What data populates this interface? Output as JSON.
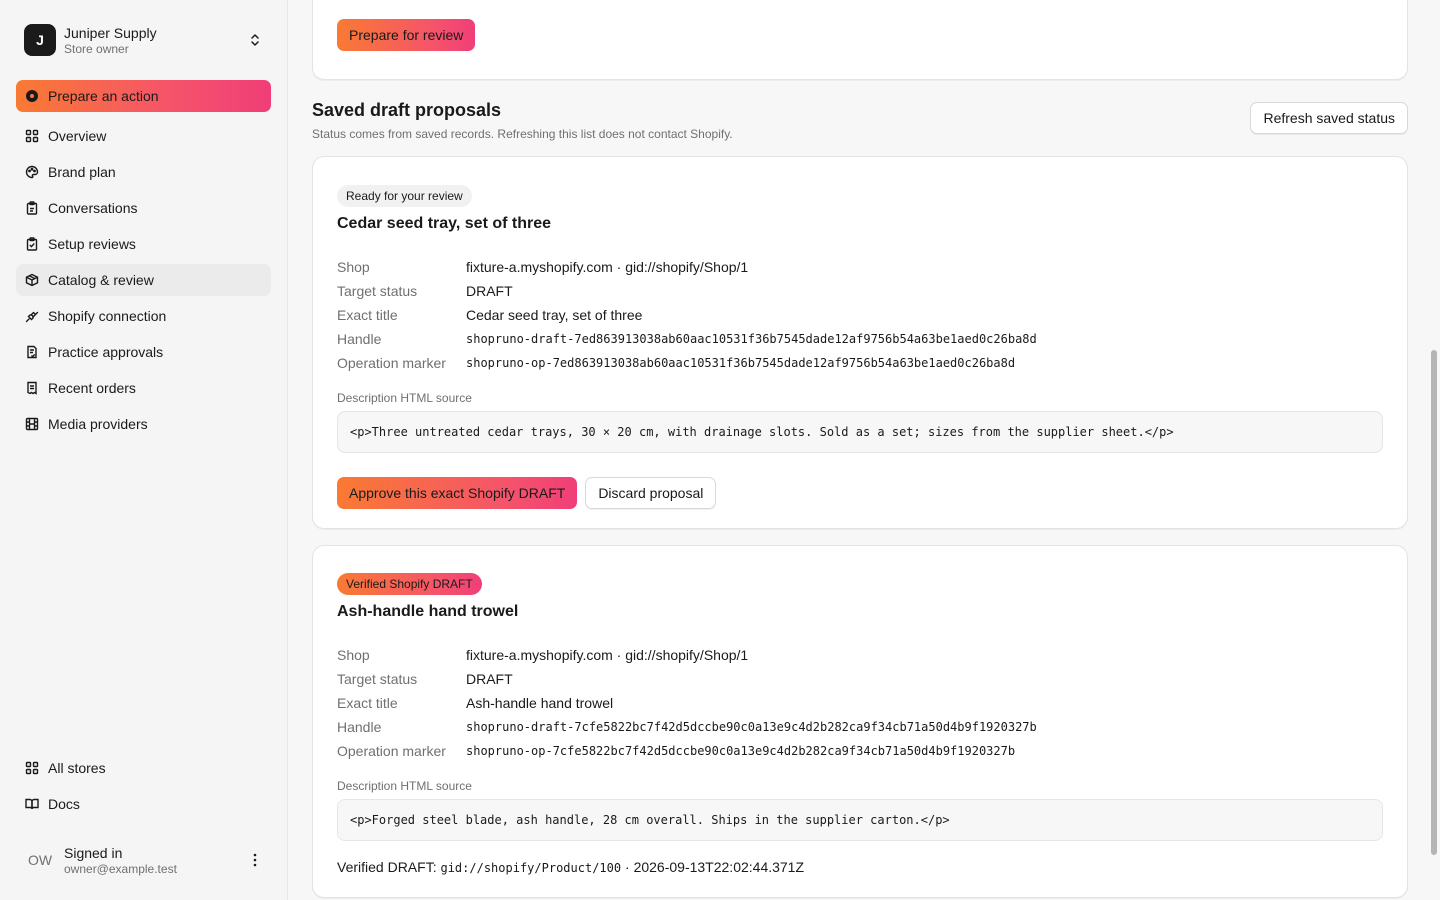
{
  "store": {
    "initial": "J",
    "name": "Juniper Supply",
    "role": "Store owner"
  },
  "nav": {
    "primary": "Prepare an action",
    "items": [
      {
        "label": "Overview"
      },
      {
        "label": "Brand plan"
      },
      {
        "label": "Conversations"
      },
      {
        "label": "Setup reviews"
      },
      {
        "label": "Catalog & review"
      },
      {
        "label": "Shopify connection"
      },
      {
        "label": "Practice approvals"
      },
      {
        "label": "Recent orders"
      },
      {
        "label": "Media providers"
      }
    ],
    "bottom": [
      {
        "label": "All stores"
      },
      {
        "label": "Docs"
      }
    ]
  },
  "user": {
    "initials": "OW",
    "title": "Signed in",
    "email": "owner@example.test"
  },
  "top_card": {
    "button": "Prepare for review"
  },
  "section": {
    "title": "Saved draft proposals",
    "subtitle": "Status comes from saved records. Refreshing this list does not contact Shopify.",
    "refresh_label": "Refresh saved status"
  },
  "labels": {
    "shop": "Shop",
    "target_status": "Target status",
    "exact_title": "Exact title",
    "handle": "Handle",
    "operation_marker": "Operation marker",
    "description_source": "Description HTML source"
  },
  "proposals": [
    {
      "badge": "Ready for your review",
      "title": "Cedar seed tray, set of three",
      "shop": "fixture-a.myshopify.com · gid://shopify/Shop/1",
      "target_status": "DRAFT",
      "exact_title": "Cedar seed tray, set of three",
      "handle": "shopruno-draft-7ed863913038ab60aac10531f36b7545dade12af9756b54a63be1aed0c26ba8d",
      "operation_marker": "shopruno-op-7ed863913038ab60aac10531f36b7545dade12af9756b54a63be1aed0c26ba8d",
      "description_html": "<p>Three untreated cedar trays, 30 × 20 cm, with drainage slots. Sold as a set; sizes from the supplier sheet.</p>",
      "approve_label": "Approve this exact Shopify DRAFT",
      "discard_label": "Discard proposal"
    },
    {
      "badge": "Verified Shopify DRAFT",
      "title": "Ash-handle hand trowel",
      "shop": "fixture-a.myshopify.com · gid://shopify/Shop/1",
      "target_status": "DRAFT",
      "exact_title": "Ash-handle hand trowel",
      "handle": "shopruno-draft-7cfe5822bc7f42d5dccbe90c0a13e9c4d2b282ca9f34cb71a50d4b9f1920327b",
      "operation_marker": "shopruno-op-7cfe5822bc7f42d5dccbe90c0a13e9c4d2b282ca9f34cb71a50d4b9f1920327b",
      "description_html": "<p>Forged steel blade, ash handle, 28 cm overall. Ships in the supplier carton.</p>",
      "verified_prefix": "Verified DRAFT:",
      "verified_gid": "gid://shopify/Product/100",
      "verified_sep": "·",
      "verified_time": "2026-09-13T22:02:44.371Z"
    }
  ]
}
